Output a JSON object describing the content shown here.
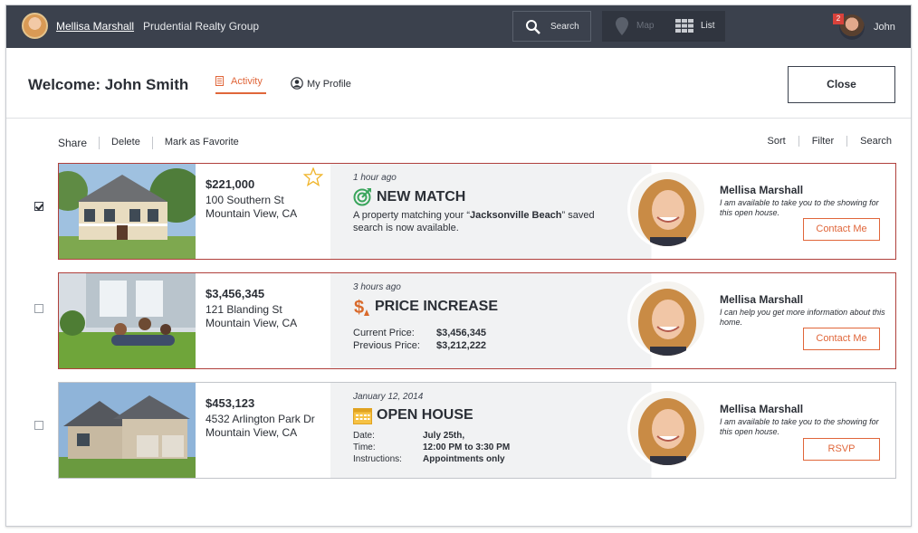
{
  "topbar": {
    "agent_name": "Mellisa Marshall",
    "company": "Prudential Realty Group",
    "search_label": "Search",
    "map_label": "Map",
    "list_label": "List",
    "notification_count": "2",
    "user_name": "John"
  },
  "header": {
    "welcome": "Welcome:  John Smith",
    "tab_activity": "Activity",
    "tab_profile": "My Profile",
    "close_label": "Close"
  },
  "actions": {
    "share": "Share",
    "delete": "Delete",
    "favorite": "Mark as Favorite"
  },
  "tools": {
    "sort": "Sort",
    "filter": "Filter",
    "search": "Search"
  },
  "cards": [
    {
      "checked": true,
      "price": "$221,000",
      "street": "100 Southern St",
      "city": "Mountain View, CA",
      "favorite_icon": "star-outline-icon",
      "when": "1 hour ago",
      "event_icon": "target-arrow-icon",
      "event_title": "NEW MATCH",
      "desc_prefix": "A property matching your “",
      "desc_search": "Jacksonville Beach",
      "desc_suffix": "” saved search is now available.",
      "agent_name": "Mellisa Marshall",
      "agent_note": "I am available to take you to the showing for this open house.",
      "button": "Contact Me"
    },
    {
      "checked": false,
      "price": "$3,456,345",
      "street": "121 Blanding St",
      "city": "Mountain View, CA",
      "when": "3 hours ago",
      "event_icon": "dollar-arrow-icon",
      "event_title": "PRICE INCREASE",
      "current_price_label": "Current Price:",
      "current_price": "$3,456,345",
      "previous_price_label": "Previous Price:",
      "previous_price": "$3,212,222",
      "agent_name": "Mellisa Marshall",
      "agent_note": "I can help you get more information about this home.",
      "button": "Contact Me"
    },
    {
      "checked": false,
      "price": "$453,123",
      "street": "4532 Arlington Park Dr",
      "city": "Mountain View, CA",
      "when": "January 12, 2014",
      "event_icon": "calendar-icon",
      "event_title": "OPEN HOUSE",
      "date_label": "Date:",
      "date": "July 25th,",
      "time_label": "Time:",
      "time": "12:00 PM to 3:30 PM",
      "instructions_label": "Instructions:",
      "instructions": "Appointments only",
      "agent_name": "Mellisa Marshall",
      "agent_note": "I am available to take you to the showing for this open house.",
      "button": "RSVP"
    }
  ],
  "colors": {
    "accent": "#e0663a",
    "topbar": "#3b414d",
    "active_border": "#b0403c",
    "star": "#f0b429"
  }
}
